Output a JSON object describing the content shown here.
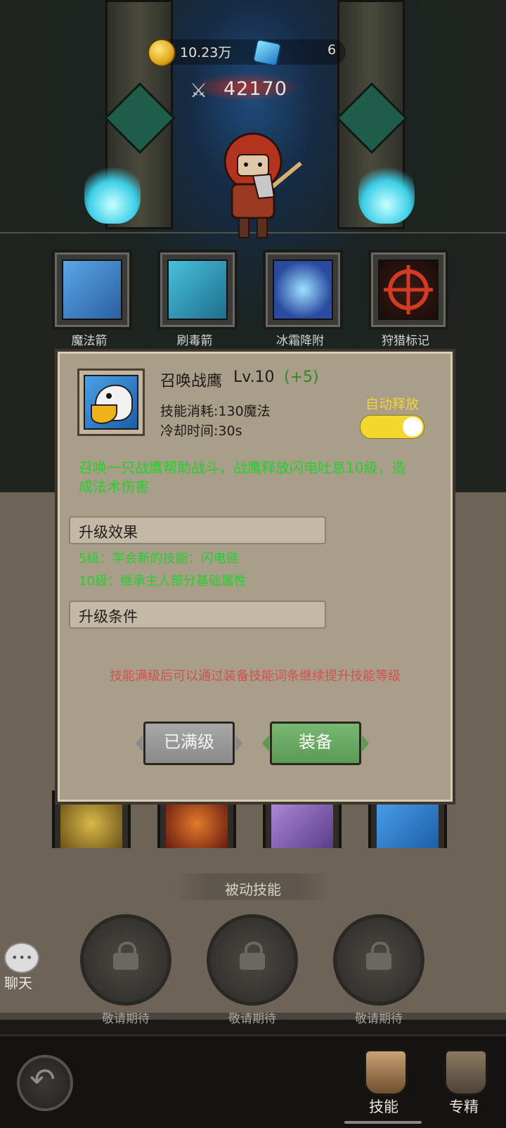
{
  "currency": {
    "coins": "10.23万",
    "gems": "6",
    "power": "42170"
  },
  "skills_top": [
    {
      "label": "魔法箭",
      "color": "#4b92d8"
    },
    {
      "label": "刷毒箭",
      "color": "#39a7c9"
    },
    {
      "label": "冰霜降附",
      "color": "#3e6bd0"
    },
    {
      "label": "狩猎标记",
      "color": "#c13b2a"
    }
  ],
  "dialog": {
    "skill_name": "召唤战鹰",
    "level": "Lv.10",
    "level_bonus": "(+5)",
    "cost": "技能消耗:130魔法",
    "cooldown": "冷却时间:30s",
    "auto_label": "自动释放",
    "description": "召唤一只战鹰帮助战斗，战鹰释放闪电吐息10级，造成法术伤害",
    "upgrade_effects_title": "升级效果",
    "effects": [
      "5级：学会新的技能：闪电链",
      "10级：继承主人部分基础属性"
    ],
    "upgrade_conditions_title": "升级条件",
    "note": "技能满级后可以通过装备技能词条继续提升技能等级",
    "maxed_button": "已满级",
    "equip_button": "装备"
  },
  "passive": {
    "title": "被动技能",
    "slots": [
      "敬请期待",
      "敬请期待",
      "敬请期待"
    ]
  },
  "chat": {
    "label": "聊天"
  },
  "tabs": [
    {
      "label": "技能",
      "active": true
    },
    {
      "label": "专精",
      "active": false
    }
  ]
}
